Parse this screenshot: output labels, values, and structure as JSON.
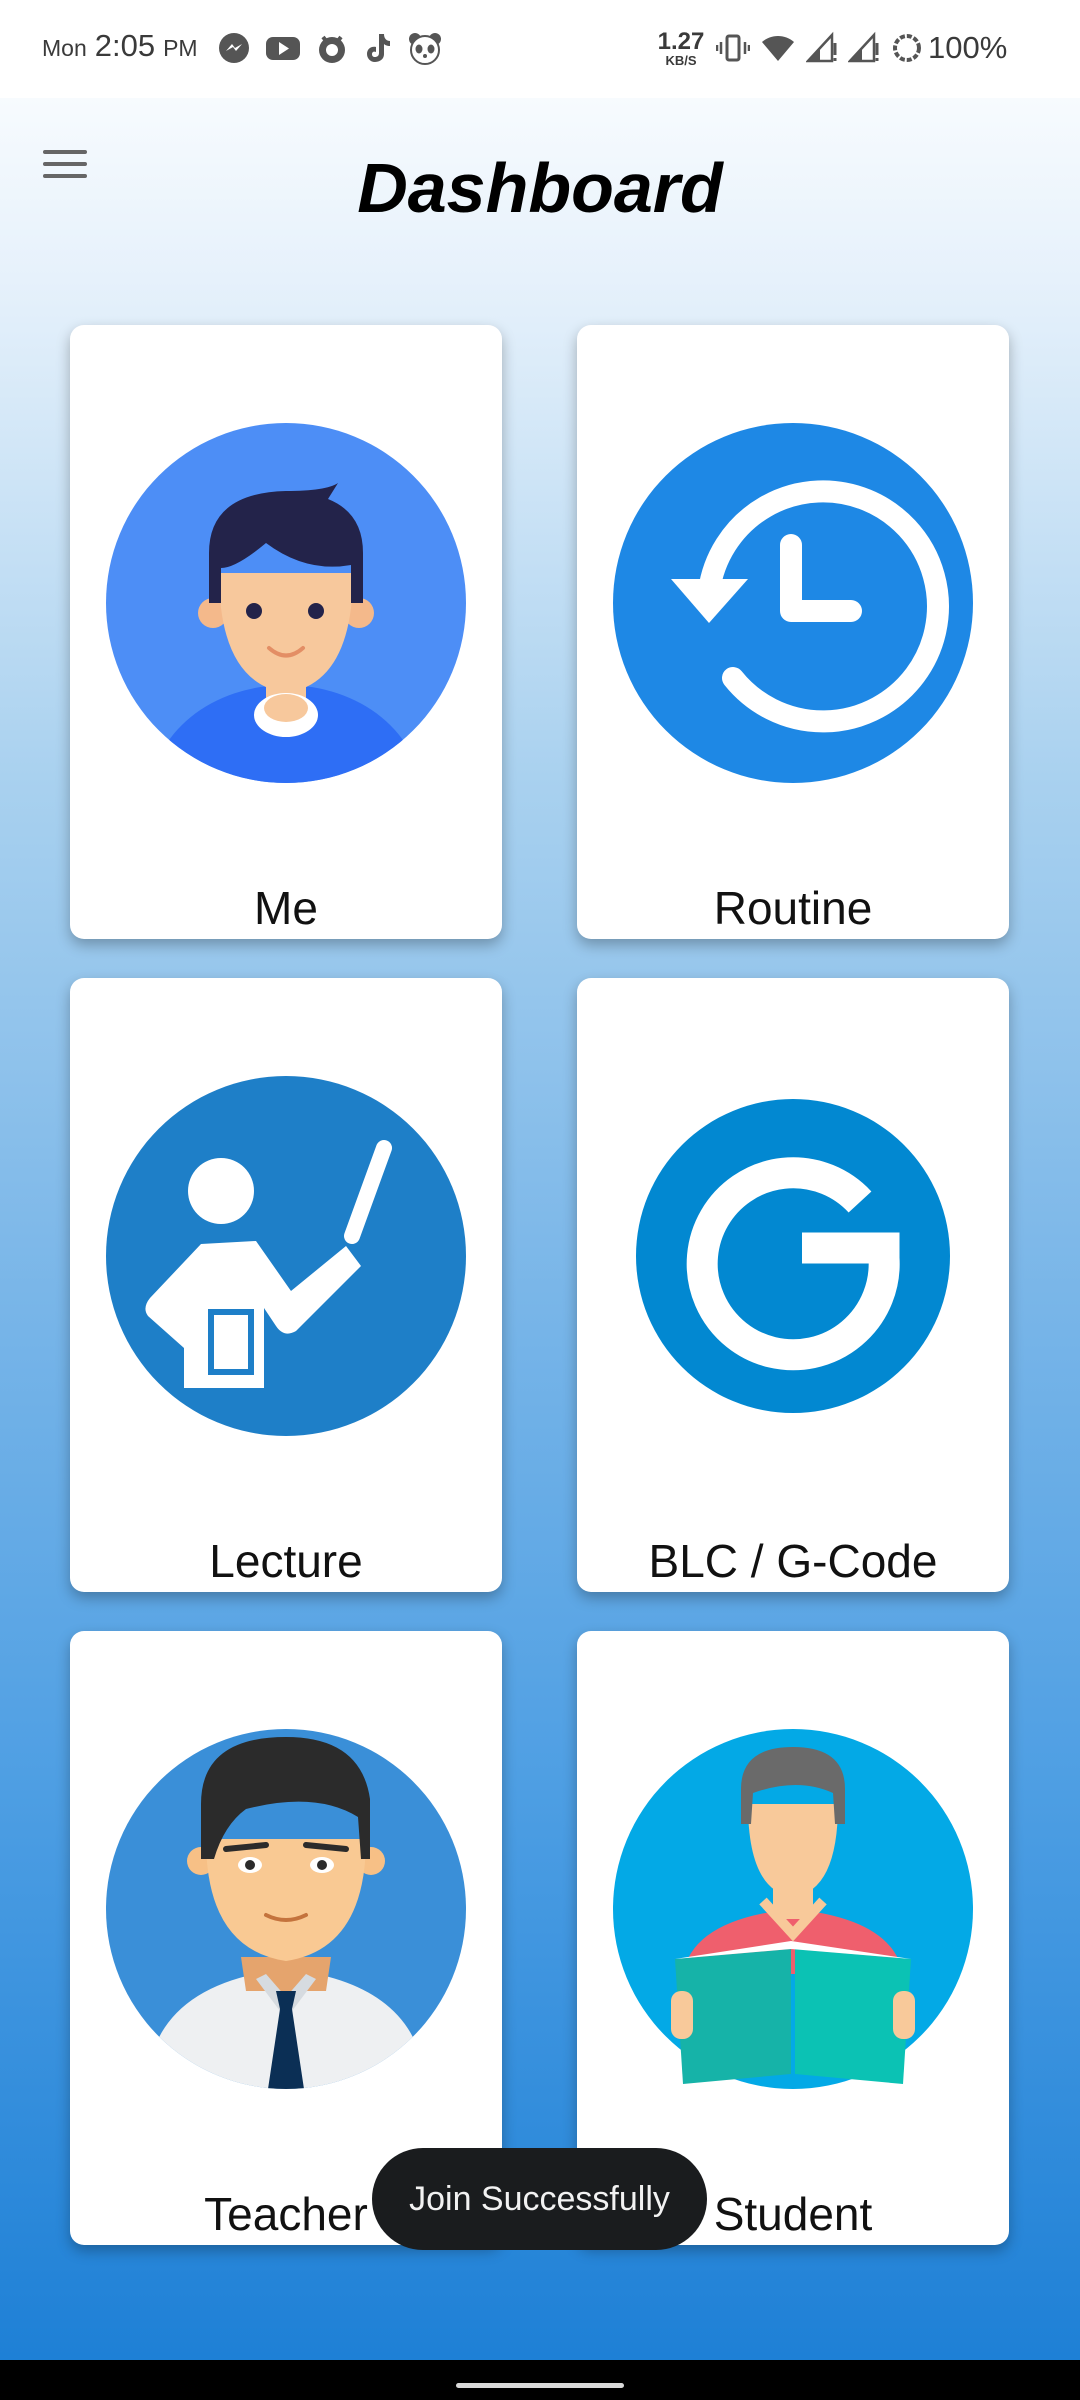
{
  "status_bar": {
    "day": "Mon",
    "time": "2:05",
    "ampm": "PM",
    "net_speed_value": "1.27",
    "net_speed_unit": "KB/S",
    "battery": "100%",
    "notification_icons": [
      "messenger-icon",
      "youtube-icon",
      "antivirus-icon",
      "tiktok-icon",
      "panda-icon"
    ],
    "system_icons": [
      "vibrate-icon",
      "wifi-icon",
      "signal-1-icon",
      "signal-2-icon",
      "battery-saver-icon"
    ]
  },
  "header": {
    "menu_icon": "hamburger-menu-icon",
    "title": "Dashboard"
  },
  "cards": [
    {
      "label": "Me",
      "icon": "user-avatar-icon"
    },
    {
      "label": "Routine",
      "icon": "history-clock-icon"
    },
    {
      "label": "Lecture",
      "icon": "lecture-teacher-icon"
    },
    {
      "label": "BLC / G-Code",
      "icon": "google-g-icon"
    },
    {
      "label": "Teacher",
      "icon": "teacher-avatar-icon"
    },
    {
      "label": "Student",
      "icon": "student-reading-icon"
    }
  ],
  "toast": {
    "message": "Join Successfully"
  },
  "colors": {
    "toast_bg": "#1a1c1e",
    "routine_blue": "#1e88e5",
    "lecture_blue": "#1e7fc8",
    "g_code_blue": "#0288d1",
    "student_cyan": "#03a9e6"
  }
}
